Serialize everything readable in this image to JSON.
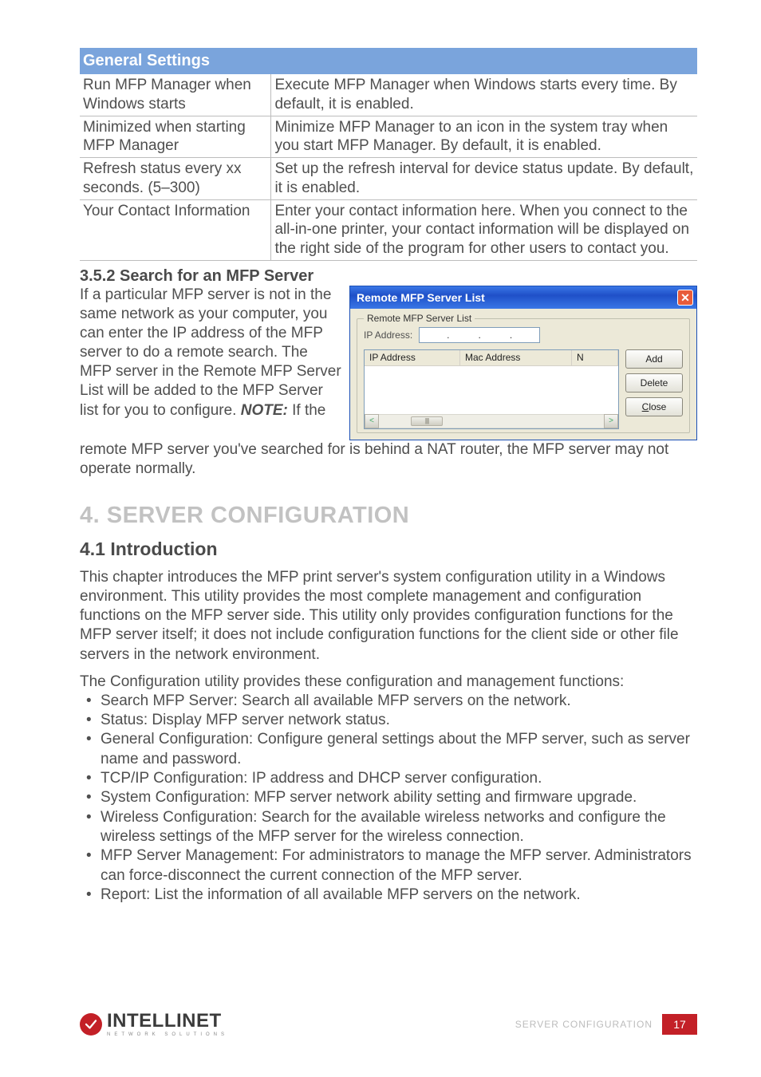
{
  "table": {
    "header": "General Settings",
    "rows": [
      {
        "k": "Run MFP Manager when Windows starts",
        "v": "Execute MFP Manager when Windows starts every time. By default, it is enabled."
      },
      {
        "k": "Minimized when starting MFP Manager",
        "v": "Minimize MFP Manager to an icon in the system tray when you start MFP Manager. By default, it is enabled."
      },
      {
        "k": "Refresh status every xx seconds. (5–300)",
        "v": "Set up the refresh interval for device status update. By default, it is enabled."
      },
      {
        "k": "Your Contact Information",
        "v": "Enter your contact information here. When you connect to the all-in-one printer, your contact information will be displayed on the right side of the program for other users to contact you."
      }
    ]
  },
  "sec352": {
    "heading": "3.5.2  Search for an MFP Server",
    "para1a": "If a particular MFP server is not in the same network as your computer, you can enter the IP address of the MFP server to do a remote search. The MFP server in the Remote MFP Server List will be added to the MFP Server list for you to configure. ",
    "noteLabel": "NOTE:",
    "para1b": " If the",
    "para2": "remote MFP server you've searched for is behind a NAT router, the MFP server may not operate normally."
  },
  "dialog": {
    "title": "Remote MFP Server List",
    "group": "Remote MFP Server List",
    "ipLabel": "IP Address:",
    "cols": {
      "c1": "IP Address",
      "c2": "Mac Address",
      "c3": "N"
    },
    "btns": {
      "add": "Add",
      "delete": "Delete",
      "close_pre": "C",
      "close_post": "lose"
    }
  },
  "sec4": {
    "heading": "4.  SERVER CONFIGURATION",
    "sub": "4.1  Introduction",
    "p1": "This chapter introduces the MFP print server's system configuration utility in a Windows environment. This utility provides the most complete management and configuration functions on the MFP server side. This utility only provides configuration functions for the MFP server itself; it does not include configuration functions for the client side or other file servers in the network environment.",
    "p2": "The Configuration utility provides these configuration and management functions:",
    "bullets": [
      "Search MFP Server: Search all available MFP servers on the network.",
      "Status: Display MFP server network status.",
      "General Configuration: Configure general settings about the MFP server, such as server name and password.",
      "TCP/IP Configuration: IP address and DHCP server configuration.",
      "System Configuration: MFP server network ability setting and firmware upgrade.",
      "Wireless Configuration: Search for the available wireless networks and configure the wireless settings of the MFP server for the wireless connection.",
      "MFP Server Management: For administrators to manage the MFP server. Administrators can force-disconnect the current connection of the MFP server.",
      "Report: List the information of all available MFP servers on the network."
    ]
  },
  "footer": {
    "brand": "INTELLINET",
    "tagline": "NETWORK SOLUTIONS",
    "section": "SERVER CONFIGURATION",
    "page": "17"
  }
}
